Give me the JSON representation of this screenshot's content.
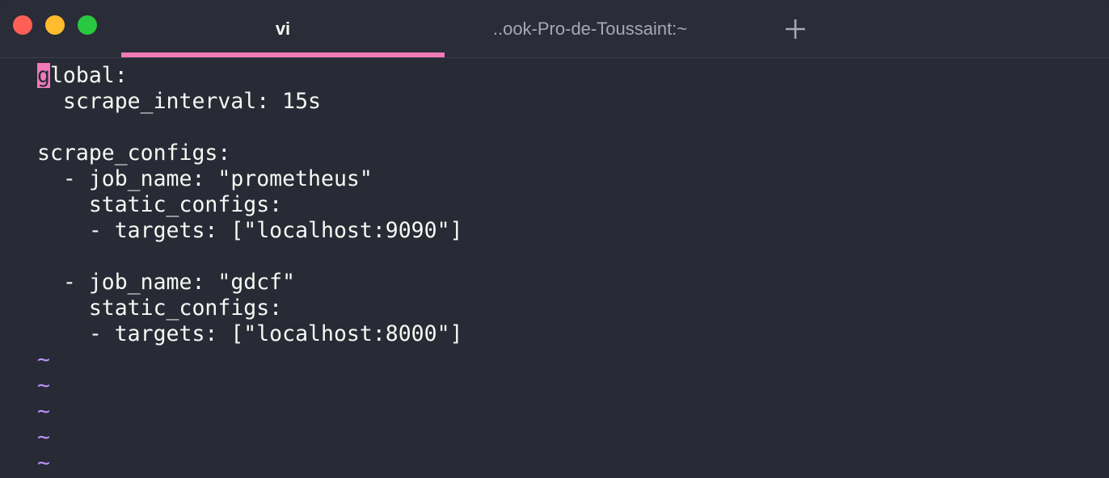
{
  "window": {
    "tabs": [
      {
        "label": "vi",
        "active": true
      },
      {
        "label": "..ook-Pro-de-Toussaint:~",
        "active": false
      }
    ],
    "new_tab_icon": "plus-icon",
    "traffic_lights": [
      "close",
      "minimize",
      "maximize"
    ]
  },
  "colors": {
    "background": "#282a36",
    "text": "#f8f8f2",
    "accent": "#f07ab8",
    "tilde": "#bd93f9"
  },
  "editor": {
    "cursor_char": "g",
    "lines": [
      "lobal:",
      "  scrape_interval: 15s",
      "",
      "scrape_configs:",
      "  - job_name: \"prometheus\"",
      "    static_configs:",
      "    - targets: [\"localhost:9090\"]",
      "",
      "  - job_name: \"gdcf\"",
      "    static_configs:",
      "    - targets: [\"localhost:8000\"]"
    ],
    "empty_line_marker": "~"
  }
}
